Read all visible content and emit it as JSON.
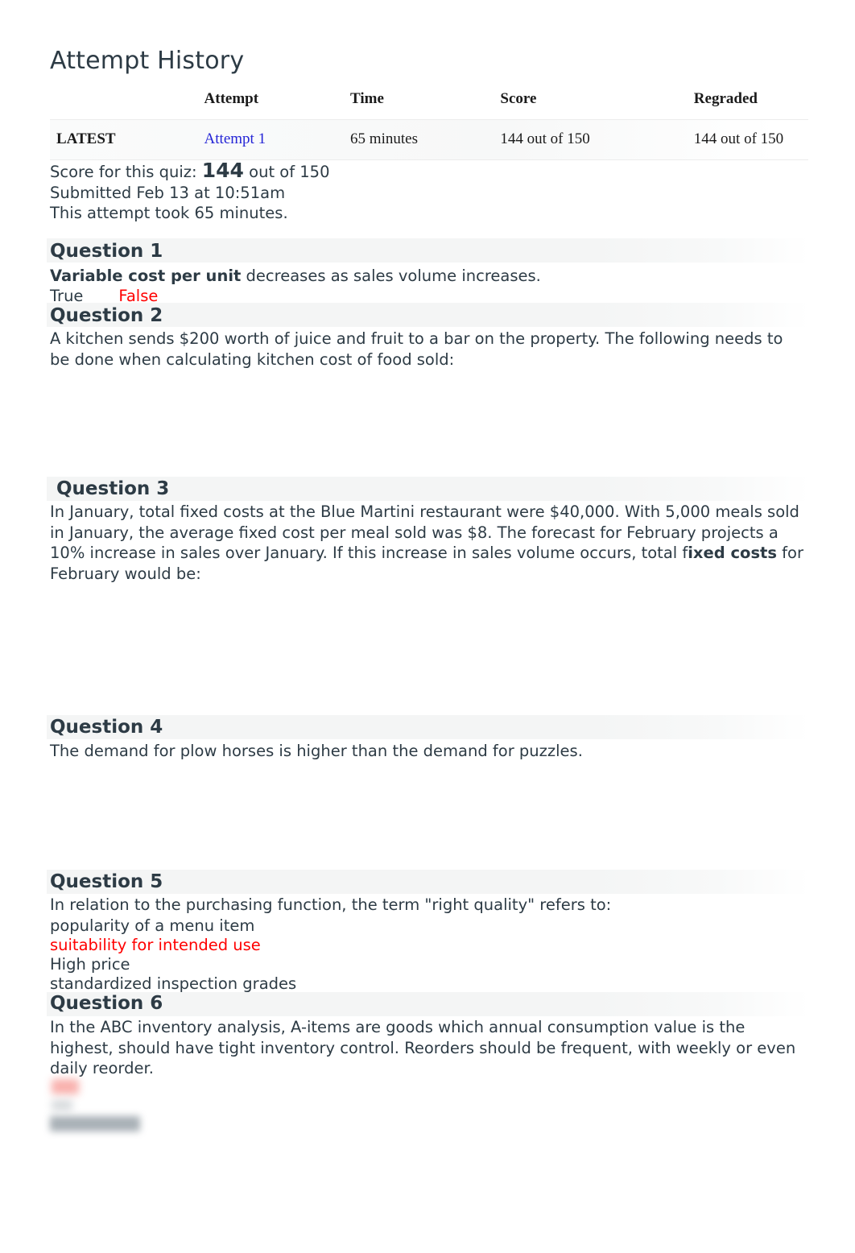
{
  "page_title": "Attempt History",
  "attempt_table": {
    "columns": [
      "",
      "Attempt",
      "Time",
      "Score",
      "Regraded"
    ],
    "rows": [
      {
        "latest_label": "LATEST",
        "attempt": "Attempt 1",
        "time": "65 minutes",
        "score": "144 out of 150",
        "regraded": "144 out of 150"
      }
    ]
  },
  "summary": {
    "score_prefix": "Score for this quiz: ",
    "score_value": "144",
    "score_suffix": " out of 150",
    "submitted": "Submitted Feb 13 at 10:51am",
    "duration": "This attempt took 65 minutes."
  },
  "questions": [
    {
      "heading": "Question 1",
      "text_bold": "Variable cost per unit",
      "text_rest": " decreases as sales volume increases.",
      "options": [
        "True",
        "False"
      ]
    },
    {
      "heading": "Question 2",
      "text": "A kitchen sends $200 worth of juice and fruit to a bar on the property. The following needs to be done when calculating kitchen cost of food sold:"
    },
    {
      "heading": " Question 3",
      "text_part1": "In January, total fixed costs at the Blue Martini restaurant were $40,000. With 5,000 meals sold in January, the average fixed cost per meal sold was $8. The forecast for February projects a 10% increase in sales over January. If this increase in sales volume occurs, total f",
      "text_bold": "ixed costs",
      "text_part2": " for February would be:"
    },
    {
      "heading": "Question 4",
      "text": "The demand for plow horses is higher than the demand for puzzles."
    },
    {
      "heading": "Question 5",
      "text": "In relation to the purchasing function, the term \"right quality\" refers to:",
      "options": [
        "popularity of a menu item",
        "suitability for intended use",
        "High price",
        "standardized inspection grades"
      ]
    },
    {
      "heading": "Question 6",
      "text": "In the ABC inventory analysis, A-items are goods which annual consumption value is the highest, should have tight inventory control. Reorders should be frequent, with weekly or even daily reorder."
    }
  ],
  "colors": {
    "heading": "#2d3b45",
    "body": "#2d3b45",
    "selected_red": "#ff0000",
    "link_blue": "#2424d6",
    "band_gray": "#f4f5f5"
  }
}
